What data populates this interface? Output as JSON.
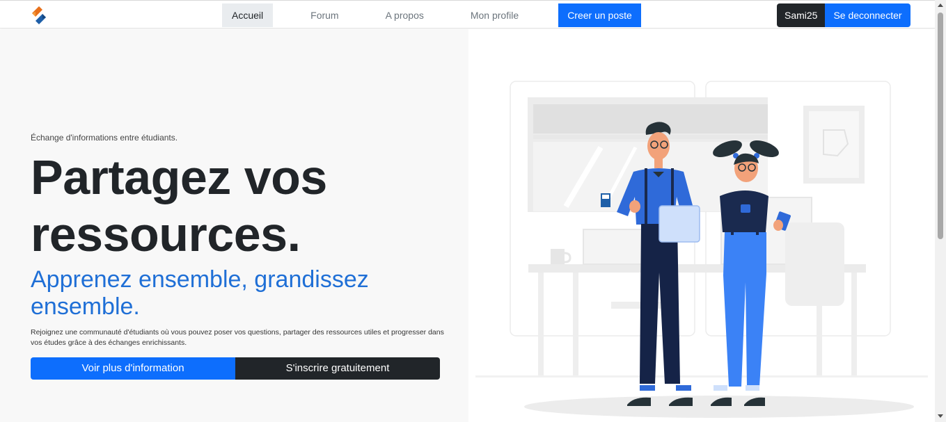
{
  "nav": {
    "logo_icon": "brand-logo-icon",
    "links": [
      {
        "label": "Accueil"
      },
      {
        "label": "Forum"
      },
      {
        "label": "A propos"
      },
      {
        "label": "Mon profile"
      }
    ],
    "cta_label": "Creer un poste",
    "user_label": "Sami25",
    "logout_label": "Se deconnecter"
  },
  "hero": {
    "eyebrow": "Échange d'informations entre étudiants.",
    "headline": "Partagez vos ressources.",
    "subheadline": "Apprenez ensemble, grandissez ensemble.",
    "description": "Rejoignez une communauté d'étudiants où vous pouvez poser vos questions, partager des ressources utiles et progresser dans vos études grâce à des échanges enrichissants.",
    "primary_button": "Voir plus d'information",
    "secondary_button": "S'inscrire gratuitement"
  },
  "colors": {
    "primary": "#0d6efd",
    "dark": "#212529",
    "accent_text": "#1f6fd6"
  }
}
